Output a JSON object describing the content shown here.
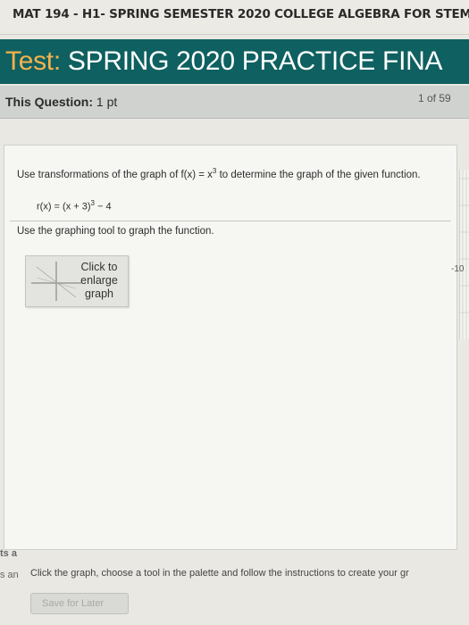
{
  "header": {
    "course_title": "MAT 194 - H1- SPRING SEMESTER 2020 COLLEGE ALGEBRA FOR STEM"
  },
  "test": {
    "label": "Test:",
    "name": "SPRING 2020 PRACTICE FINA"
  },
  "question": {
    "label": "This Question:",
    "points": "1 pt",
    "counter": "1 of 59"
  },
  "problem": {
    "instruction_prefix": "Use transformations of the graph of f(x) = x",
    "instruction_exp": "3",
    "instruction_suffix": " to determine the graph of the given function.",
    "function_prefix": "r(x) = (x + 3)",
    "function_exp": "3",
    "function_suffix": " − 4",
    "tool_instruction": "Use the graphing tool to graph the function."
  },
  "graph_thumb": {
    "label": "Click to enlarge graph"
  },
  "side_graph": {
    "tick_label": "-10"
  },
  "left_clipped": {
    "line1": "ts a",
    "line2": "s an"
  },
  "footer": {
    "instruction": "Click the graph, choose a tool in the palette and follow the instructions to create your gr",
    "save_label": "Save for Later"
  },
  "colors": {
    "test_bar": "#0f6060",
    "test_label": "#f2b24e"
  }
}
